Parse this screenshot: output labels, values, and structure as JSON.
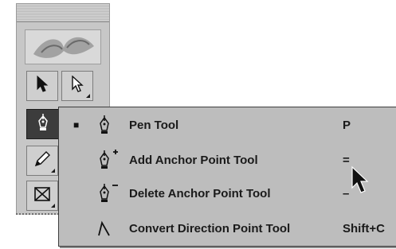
{
  "toolbox": {
    "tools": [
      {
        "name": "selection",
        "icon": "black-arrow-icon"
      },
      {
        "name": "direct-selection",
        "icon": "white-arrow-icon"
      },
      {
        "name": "pen",
        "icon": "pen-icon",
        "active": true
      },
      {
        "name": "pencil",
        "icon": "pencil-icon"
      },
      {
        "name": "rectangle-frame",
        "icon": "frame-icon"
      }
    ]
  },
  "menu": {
    "items": [
      {
        "label": "Pen Tool",
        "shortcut": "P",
        "selected": true,
        "check": "■",
        "icon": "pen-icon"
      },
      {
        "label": "Add Anchor Point Tool",
        "shortcut": "=",
        "selected": false,
        "check": "",
        "icon": "add-anchor-icon"
      },
      {
        "label": "Delete Anchor Point Tool",
        "shortcut": "–",
        "selected": false,
        "check": "",
        "icon": "delete-anchor-icon"
      },
      {
        "label": "Convert Direction Point Tool",
        "shortcut": "Shift+C",
        "selected": false,
        "check": "",
        "icon": "convert-point-icon"
      }
    ]
  }
}
